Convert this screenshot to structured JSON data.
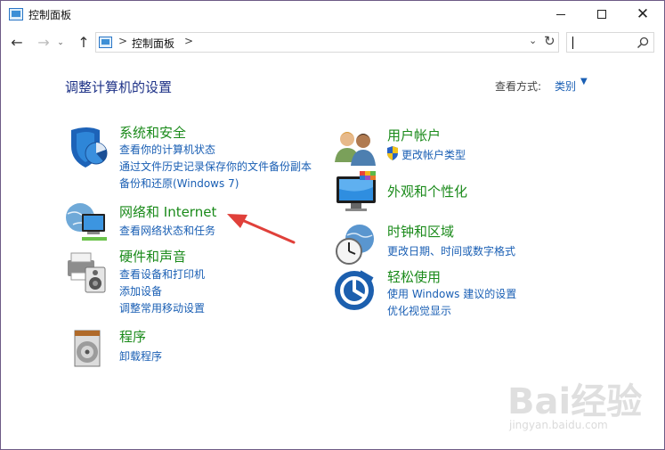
{
  "window": {
    "title": "控制面板"
  },
  "address": {
    "sep": ">",
    "path": "控制面板"
  },
  "content": {
    "heading": "调整计算机的设置",
    "view_by_label": "查看方式:",
    "view_by_value": "类别"
  },
  "categories": {
    "system_security": {
      "title": "系统和安全",
      "links": [
        "查看你的计算机状态",
        "通过文件历史记录保存你的文件备份副本",
        "备份和还原(Windows 7)"
      ]
    },
    "network": {
      "title": "网络和 Internet",
      "links": [
        "查看网络状态和任务"
      ]
    },
    "hardware": {
      "title": "硬件和声音",
      "links": [
        "查看设备和打印机",
        "添加设备",
        "调整常用移动设置"
      ]
    },
    "programs": {
      "title": "程序",
      "links": [
        "卸载程序"
      ]
    },
    "user_accounts": {
      "title": "用户帐户",
      "links": [
        "更改帐户类型"
      ]
    },
    "appearance": {
      "title": "外观和个性化",
      "links": []
    },
    "clock_region": {
      "title": "时钟和区域",
      "links": [
        "更改日期、时间或数字格式"
      ]
    },
    "ease_of_access": {
      "title": "轻松使用",
      "links": [
        "使用 Windows 建议的设置",
        "优化视觉显示"
      ]
    }
  },
  "watermark": {
    "brand": "Bai经验",
    "url": "jingyan.baidu.com"
  },
  "colors": {
    "title_green": "#1a8a1a",
    "link_blue": "#1a5fb4",
    "heading_blue": "#1e3287",
    "annotation_red": "#e0403a"
  }
}
